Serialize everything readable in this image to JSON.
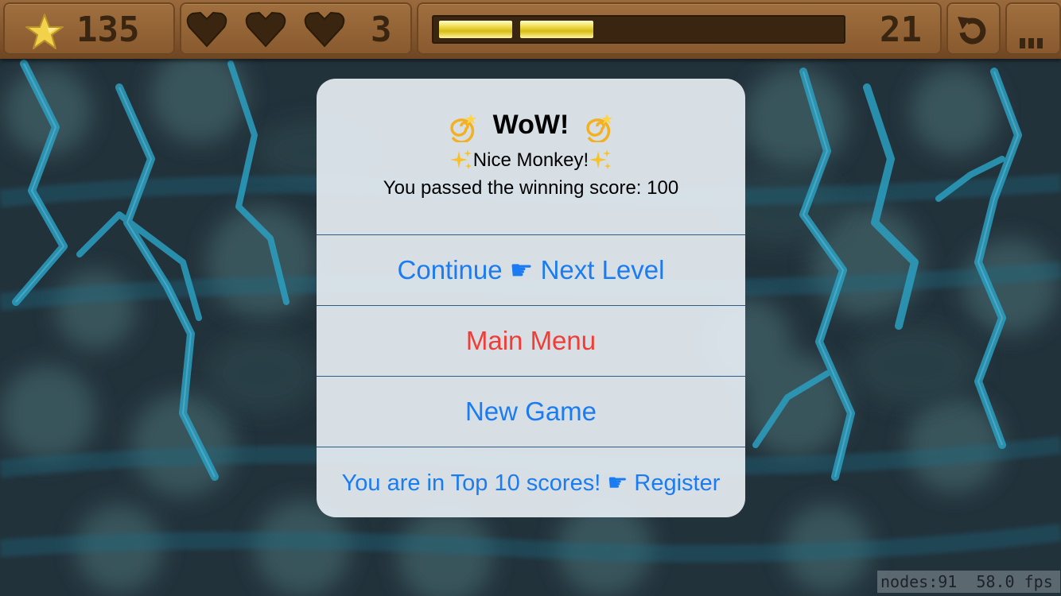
{
  "hud": {
    "score": "135",
    "lives": "3",
    "progress_segments_filled": 2,
    "timer": "21"
  },
  "icons": {
    "score": "star-icon",
    "lives": "heart-icon",
    "restart": "restart-icon",
    "pause": "pause-icon"
  },
  "alert": {
    "title": "WoW!",
    "title_emoji": "dizzy-icon",
    "line1": "Nice Monkey!",
    "line1_emoji": "sparkles-icon",
    "line2": "You passed the winning score: 100",
    "buttons": [
      {
        "pre": "Continue",
        "hand": "☛",
        "post": "Next Level"
      },
      {
        "label": "Main Menu"
      },
      {
        "label": "New Game"
      },
      {
        "pre": "You are in Top 10 scores!",
        "hand": "☛",
        "post": "Register"
      }
    ]
  },
  "stats": {
    "nodes": "nodes:91",
    "fps": "58.0 fps"
  },
  "colors": {
    "hud_wood": "#88592e",
    "hud_text": "#3a2510",
    "button_blue": "#1b7cf2",
    "button_red": "#f23c36",
    "bar_gold": "#e6cf2c"
  }
}
